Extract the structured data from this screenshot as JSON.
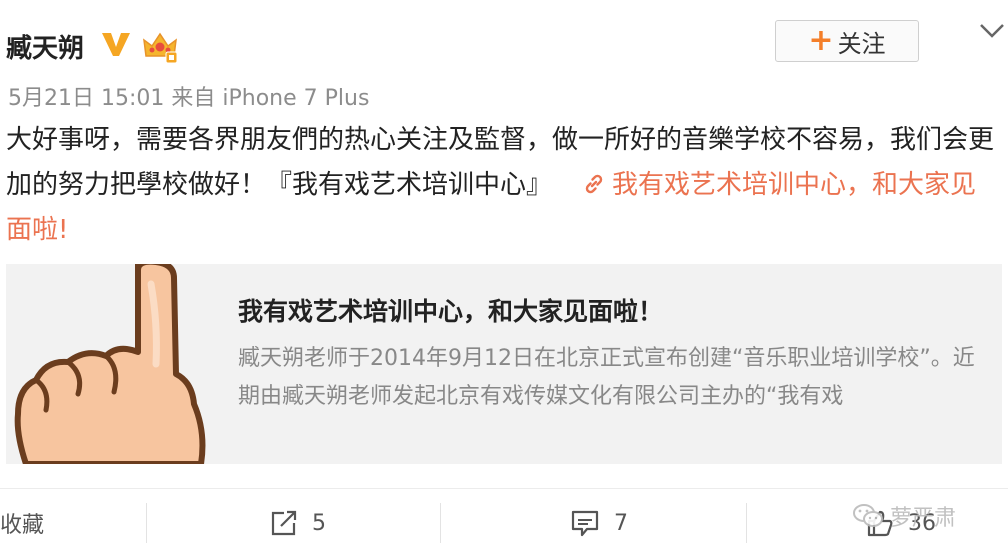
{
  "post": {
    "author": "臧天朔",
    "verified_icon": "verified-v-icon",
    "crown_icon": "crown-badge-icon",
    "follow_label": "关注",
    "meta": "5月21日 15:01 来自 iPhone 7 Plus",
    "text_before": "大好事呀，需要各界朋友們的热心关注及監督，做一所好的音樂学校不容易，我们会更加的努力把學校做好！『我有戏艺术培训中心』",
    "link_text": "我有戏艺术培训中心，和大家见面啦!"
  },
  "card": {
    "title": "我有戏艺术培训中心，和大家见面啦！",
    "description": "臧天朔老师于2014年9月12日在北京正式宣布创建“音乐职业培训学校”。近期由臧天朔老师发起北京有戏传媒文化有限公司主办的“我有戏"
  },
  "footer": {
    "favorite_label": "收藏",
    "repost_count": "5",
    "comment_count": "7",
    "like_count": "36"
  },
  "watermark": "萝严肃",
  "colors": {
    "link": "#eb7350",
    "follow_plus": "#f47f2a",
    "verified": "#f5a623",
    "meta": "#8c8c8c"
  }
}
